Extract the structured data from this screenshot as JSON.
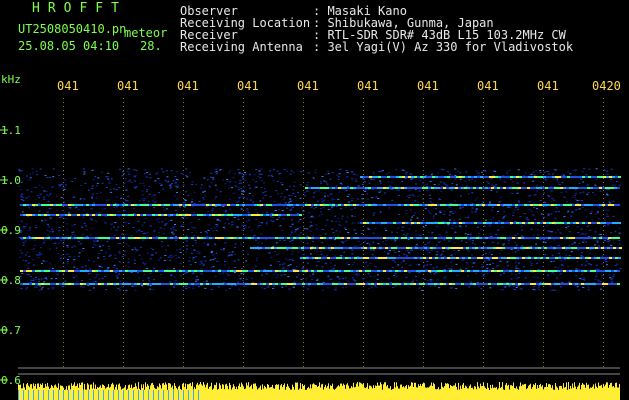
{
  "logo": "HROFFT",
  "file_name": "UT2508050410.pn",
  "mode": "meteor",
  "datetime": "25.08.05 04:10",
  "frame": "28.",
  "info_labels": [
    "Observer",
    "Receiving Location",
    "Receiver",
    "Receiving Antenna"
  ],
  "info_values": [
    ": Masaki Kano",
    ": Shibukawa, Gunma, Japan",
    ": RTL-SDR SDR# 43dB L15 103.2MHz CW",
    ": 3el Yagi(V) Az 330 for Vladivostok"
  ],
  "y_axis": {
    "unit": "kHz",
    "labels": [
      "1.1",
      "1.0",
      "0.9",
      "0.8",
      "0.7",
      "0.6"
    ]
  },
  "time_ticks": [
    "041",
    "041",
    "041",
    "041",
    "041",
    "041",
    "041",
    "041",
    "041",
    "0420"
  ],
  "colors": {
    "label_green": "#7cff4e",
    "tick_yellow": "#ffd84a",
    "info_white": "#e8e8e8",
    "signal_bar": "#ffee33"
  }
}
